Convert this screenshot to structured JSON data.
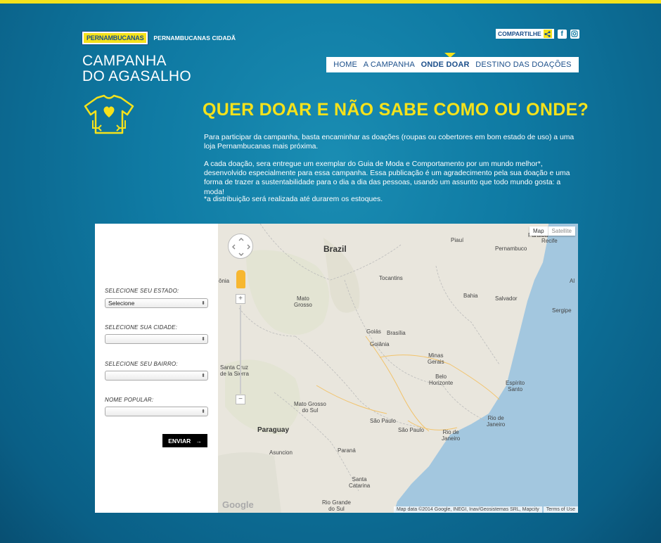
{
  "brand": {
    "logo_text": "PERNAMBUCANAS",
    "sub": "PERNAMBUCANAS CIDADÃ"
  },
  "share": {
    "label": "COMPARTILHE",
    "icons": [
      "share-icon",
      "facebook-icon",
      "instagram-icon"
    ]
  },
  "campaign": {
    "line1": "CAMPANHA",
    "line2": "DO AGASALHO",
    "icon": "tshirt-heart-icon"
  },
  "nav": {
    "items": [
      "HOME",
      "A CAMPANHA",
      "ONDE DOAR",
      "DESTINO DAS DOAÇÕES"
    ],
    "active": "ONDE DOAR"
  },
  "headline": "QUER DOAR E NÃO SABE COMO OU ONDE?",
  "content": {
    "p1": "Para participar da campanha, basta encaminhar as doações (roupas ou cobertores em bom estado de uso) a uma loja Pernambucanas mais próxima.",
    "p2": "A cada doação, sera entregue um exemplar do Guia de Moda e Comportamento por um mundo melhor*, desenvolvido especialmente para essa campanha. Essa publicação é um agradecimento pela sua doação e uma forma de trazer a sustentabilidade para o dia a dia das pessoas, usando um assunto que todo mundo gosta: a moda!",
    "p3": "*a distribuição será realizada até durarem os estoques."
  },
  "form": {
    "estado_label": "SELECIONE SEU ESTADO:",
    "estado_value": "Selecione",
    "cidade_label": "SELECIONE SUA CIDADE:",
    "cidade_value": "",
    "bairro_label": "SELECIONE SEU BAIRRO:",
    "bairro_value": "",
    "popular_label": "NOME POPULAR:",
    "popular_value": "",
    "submit": "ENVIAR"
  },
  "map": {
    "type_map": "Map",
    "type_satellite": "Satellite",
    "labels": {
      "brazil": "Brazil",
      "piaui": "Piauí",
      "recife": "Recife",
      "paraiba": "Paraíba",
      "pernambuco": "Pernambuco",
      "al": "Al",
      "tocantins": "Tocantins",
      "rondonia": "ônia",
      "bahia": "Bahia",
      "salvador": "Salvador",
      "sergipe": "Sergipe",
      "mato_grosso": "Mato\nGrosso",
      "goias": "Goiás",
      "brasilia": "Brasília",
      "goiania": "Goiânia",
      "minas": "Minas\nGerais",
      "bh": "Belo\nHorizonte",
      "es": "Espírito\nSanto",
      "santa_cruz": "Santa Cruz\nde la Sierra",
      "ms": "Mato Grosso\ndo Sul",
      "sp": "São Paulo",
      "sp_city": "São Paulo",
      "rj": "Rio de\nJaneiro",
      "rj_city": "Rio de\nJaneiro",
      "paraguay": "Paraguay",
      "asuncion": "Asuncion",
      "parana": "Paraná",
      "sc": "Santa\nCatarina",
      "rs": "Rio Grande\ndo Sul"
    },
    "google": "Google",
    "attribution": "Map data ©2014 Google, INEGI, Inav/Geosistemas SRL, Mapcity",
    "terms": "Terms of Use"
  }
}
